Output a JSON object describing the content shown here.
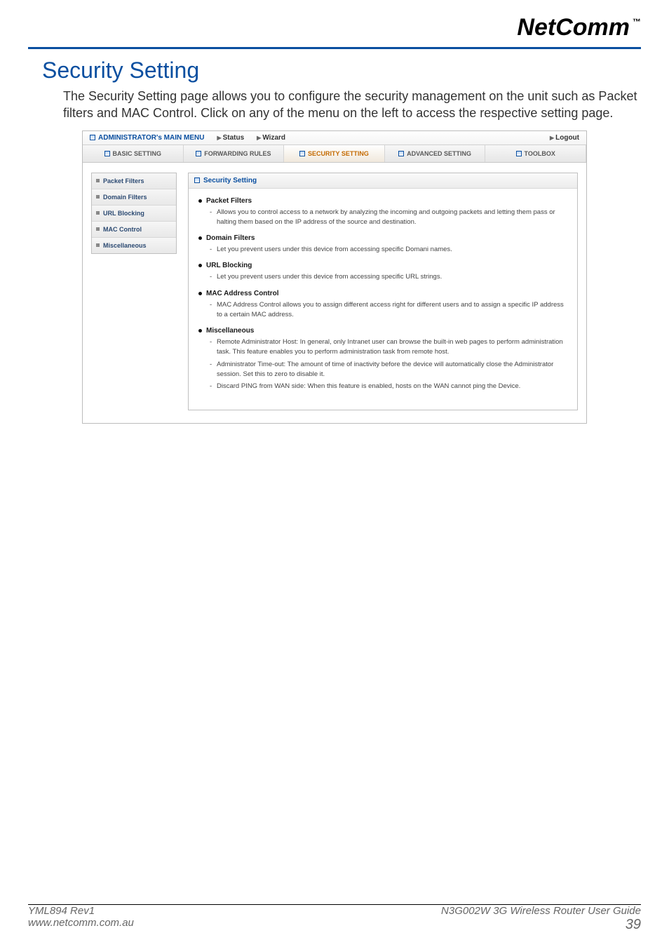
{
  "brand": {
    "name": "NetComm",
    "tm": "™"
  },
  "page": {
    "title": "Security Setting",
    "intro": "The Security Setting page allows you to configure the security management on the unit such as Packet filters and MAC Control. Click on any of the menu on the left to access the respective setting page."
  },
  "topbar": {
    "main_menu": "ADMINISTRATOR's MAIN MENU",
    "status": "Status",
    "wizard": "Wizard",
    "logout": "Logout"
  },
  "tabs": {
    "basic": "BASIC SETTING",
    "forwarding": "FORWARDING RULES",
    "security": "SECURITY SETTING",
    "advanced": "ADVANCED SETTING",
    "toolbox": "TOOLBOX"
  },
  "sidemenu": {
    "items": [
      {
        "label": "Packet Filters"
      },
      {
        "label": "Domain Filters"
      },
      {
        "label": "URL Blocking"
      },
      {
        "label": "MAC Control"
      },
      {
        "label": "Miscellaneous"
      }
    ]
  },
  "card": {
    "header": "Security Setting",
    "sections": [
      {
        "name": "Packet Filters",
        "bullets": [
          "Allows you to control access to a network by analyzing the incoming and outgoing packets and letting them pass or halting them based on the IP address of the source and destination."
        ]
      },
      {
        "name": "Domain Filters",
        "bullets": [
          "Let you prevent users under this device from accessing specific Domani names."
        ]
      },
      {
        "name": "URL Blocking",
        "bullets": [
          "Let you prevent users under this device from accessing specific URL strings."
        ]
      },
      {
        "name": "MAC Address Control",
        "bullets": [
          "MAC Address Control allows you to assign different access right for different users and to assign a specific IP address to a certain MAC address."
        ]
      },
      {
        "name": "Miscellaneous",
        "bullets": [
          "Remote Administrator Host: In general, only Intranet user can browse the built-in web pages to perform administration task. This feature enables you to perform administration task from remote host.",
          "Administrator Time-out: The amount of time of inactivity before the device will automatically close the Administrator session. Set this to zero to disable it.",
          "Discard PING from WAN side: When this feature is enabled, hosts on the WAN cannot ping the Device."
        ]
      }
    ]
  },
  "footer": {
    "left1": "YML894 Rev1",
    "left2": "www.netcomm.com.au",
    "right1": "N3G002W 3G Wireless Router User Guide",
    "right2": "39"
  }
}
